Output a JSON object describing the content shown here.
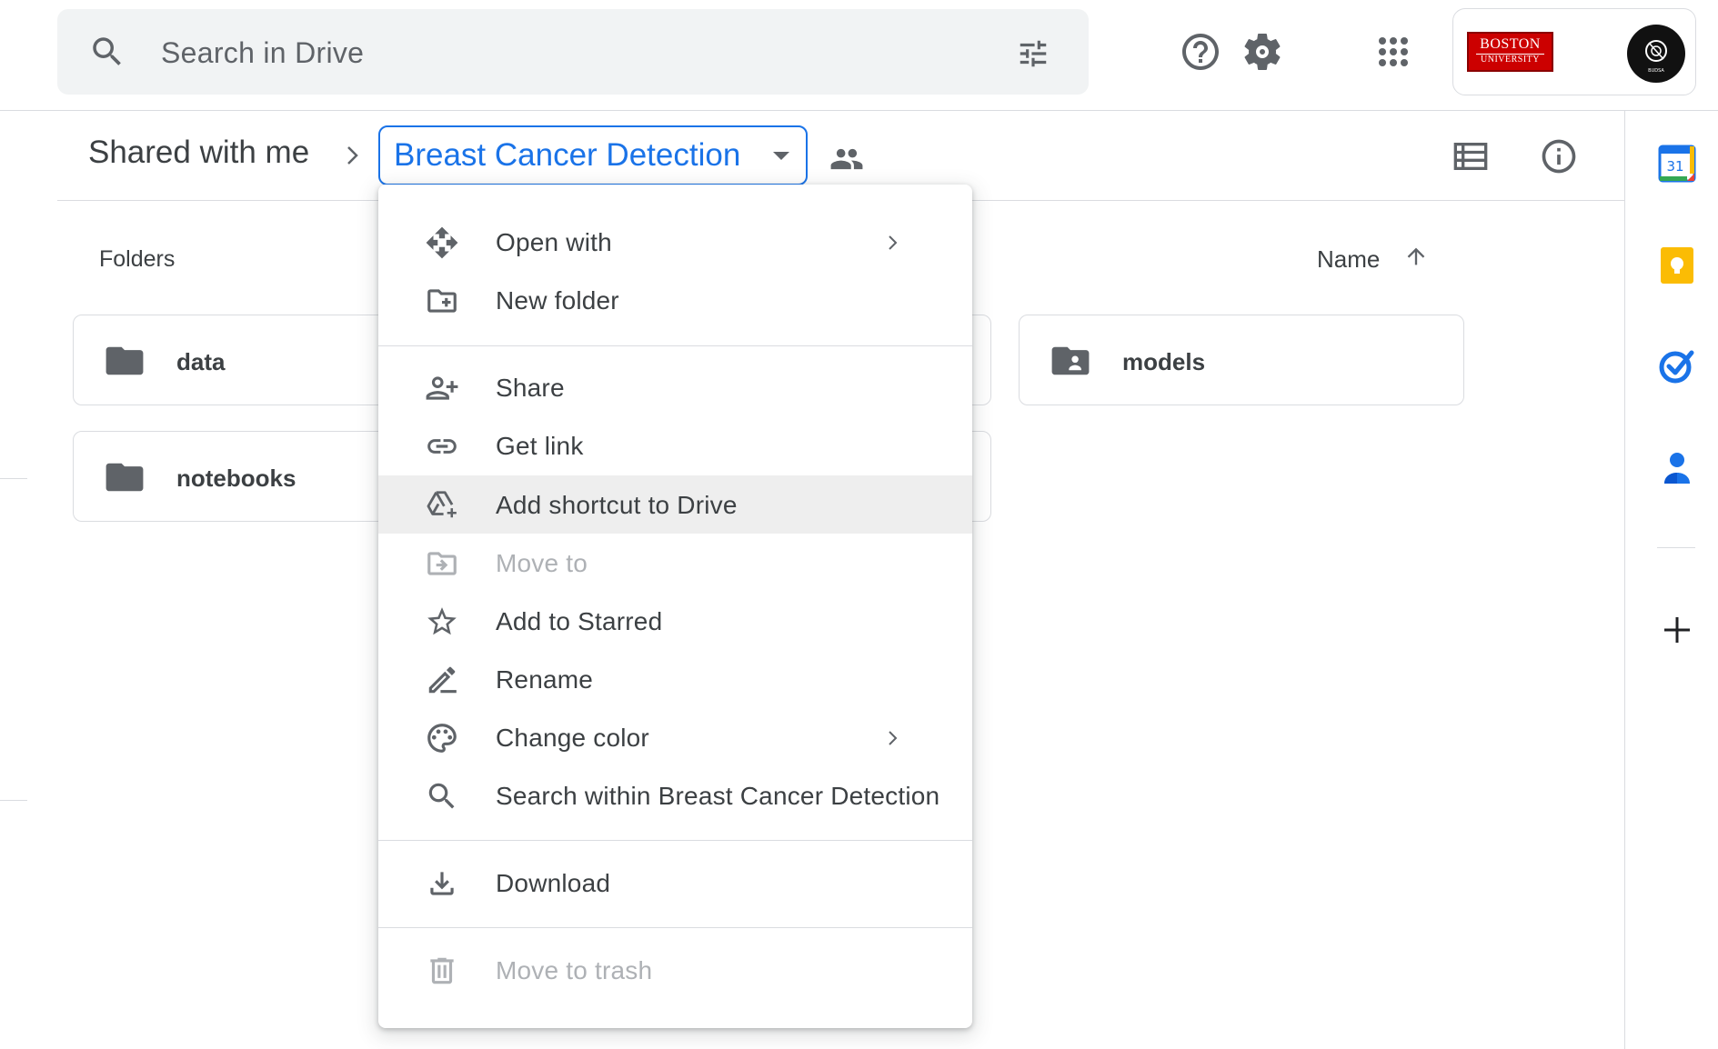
{
  "search": {
    "placeholder": "Search in Drive"
  },
  "header": {
    "account_logo_line1": "BOSTON",
    "account_logo_line2": "UNIVERSITY",
    "avatar_text": "BUDSA"
  },
  "breadcrumb": {
    "root": "Shared with me",
    "current": "Breast Cancer Detection"
  },
  "folders": {
    "section_label": "Folders",
    "sort_label": "Name",
    "items": [
      {
        "name": "data",
        "icon": "folder-icon"
      },
      {
        "name": "models",
        "icon": "shared-folder-icon"
      },
      {
        "name": "notebooks",
        "icon": "folder-icon"
      }
    ]
  },
  "menu": {
    "items": [
      {
        "label": "Open with",
        "icon": "open-with-icon",
        "submenu": true,
        "disabled": false
      },
      {
        "label": "New folder",
        "icon": "new-folder-icon",
        "submenu": false,
        "disabled": false
      },
      {
        "label": "Share",
        "icon": "person-add-icon",
        "submenu": false,
        "disabled": false
      },
      {
        "label": "Get link",
        "icon": "link-icon",
        "submenu": false,
        "disabled": false
      },
      {
        "label": "Add shortcut to Drive",
        "icon": "add-to-drive-icon",
        "submenu": false,
        "disabled": false,
        "highlighted": true
      },
      {
        "label": "Move to",
        "icon": "move-to-icon",
        "submenu": false,
        "disabled": true
      },
      {
        "label": "Add to Starred",
        "icon": "star-icon",
        "submenu": false,
        "disabled": false
      },
      {
        "label": "Rename",
        "icon": "rename-icon",
        "submenu": false,
        "disabled": false
      },
      {
        "label": "Change color",
        "icon": "palette-icon",
        "submenu": true,
        "disabled": false
      },
      {
        "label": "Search within Breast Cancer Detection",
        "icon": "search-icon",
        "submenu": false,
        "disabled": false
      },
      {
        "label": "Download",
        "icon": "download-icon",
        "submenu": false,
        "disabled": false
      },
      {
        "label": "Move to trash",
        "icon": "trash-icon",
        "submenu": false,
        "disabled": true
      }
    ]
  },
  "side_panel": {
    "calendar_day": "31",
    "apps": [
      "calendar-icon",
      "keep-icon",
      "tasks-icon",
      "contacts-icon",
      "add-icon"
    ]
  },
  "colors": {
    "accent": "#1a73e8",
    "text": "#3c4043",
    "icon": "#5f6368",
    "disabled": "#aeb1b5",
    "highlight": "#eeeeee",
    "search_bg": "#f1f3f4",
    "bu_red": "#cc0000"
  }
}
